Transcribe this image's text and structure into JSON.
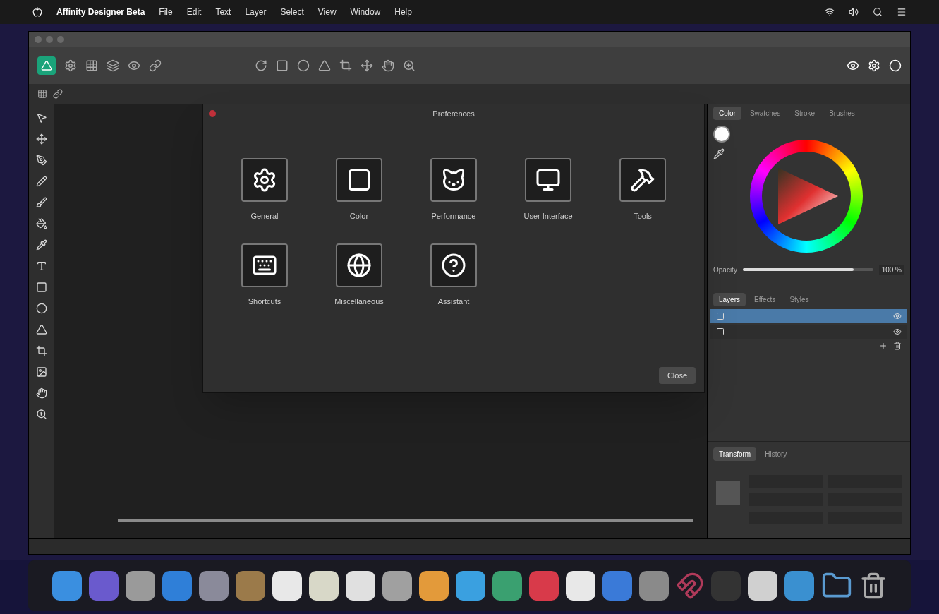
{
  "menu_bar": {
    "app_name": "Affinity Designer Beta",
    "menus": [
      "File",
      "Edit",
      "Text",
      "Layer",
      "Select",
      "View",
      "Window",
      "Help"
    ]
  },
  "dialog": {
    "title": "Preferences",
    "items": [
      {
        "label": "General",
        "kind": "general"
      },
      {
        "label": "Color",
        "kind": "color"
      },
      {
        "label": "Performance",
        "kind": "performance"
      },
      {
        "label": "User Interface",
        "kind": "interface"
      },
      {
        "label": "Tools",
        "kind": "tools"
      },
      {
        "label": "Shortcuts",
        "kind": "shortcuts"
      },
      {
        "label": "Miscellaneous",
        "kind": "misc"
      },
      {
        "label": "Assistant",
        "kind": "assistant"
      }
    ],
    "close_button": "Close"
  },
  "color_panel": {
    "tabs": [
      {
        "label": "Color",
        "selected": true
      },
      {
        "label": "Swatches",
        "selected": false
      },
      {
        "label": "Stroke",
        "selected": false
      },
      {
        "label": "Brushes",
        "selected": false
      }
    ],
    "opacity_label": "Opacity",
    "opacity": {
      "level": 0.85
    },
    "opacity_reading": "100 %"
  },
  "layers_panel": {
    "tabs": [
      {
        "label": "Layers",
        "selected": true
      },
      {
        "label": "Effects",
        "selected": false
      },
      {
        "label": "Styles",
        "selected": false
      }
    ],
    "rows": [
      {
        "selected": true
      },
      {
        "selected": false
      }
    ]
  },
  "transform_panel": {
    "tabs": [
      {
        "label": "Transform",
        "selected": true
      },
      {
        "label": "History",
        "selected": false
      }
    ]
  }
}
